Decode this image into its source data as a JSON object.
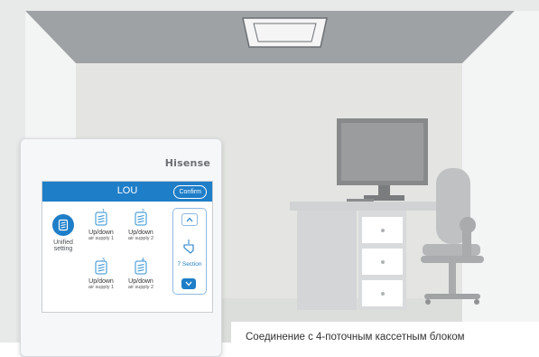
{
  "controller": {
    "brand": "Hisense",
    "screen_title": "LOU",
    "confirm_label": "Confirm",
    "unified": {
      "label_line1": "Unified",
      "label_line2": "setting",
      "icon": "louver-icon"
    },
    "louvers": [
      {
        "title": "Up/down",
        "sub": "air supply 1",
        "icon": "louver-1-icon"
      },
      {
        "title": "Up/down",
        "sub": "air supply 2",
        "icon": "louver-2-icon"
      },
      {
        "title": "Up/down",
        "sub": "air supply 1",
        "icon": "louver-3-icon"
      },
      {
        "title": "Up/down",
        "sub": "air supply 2",
        "icon": "louver-4-icon"
      }
    ],
    "section_label": "7 Section"
  },
  "caption": "Соединение с 4-поточным кассетным блоком",
  "colors": {
    "accent": "#1f7ec8",
    "wall": "#e4e5e2",
    "ceiling": "#9ea2a5"
  }
}
